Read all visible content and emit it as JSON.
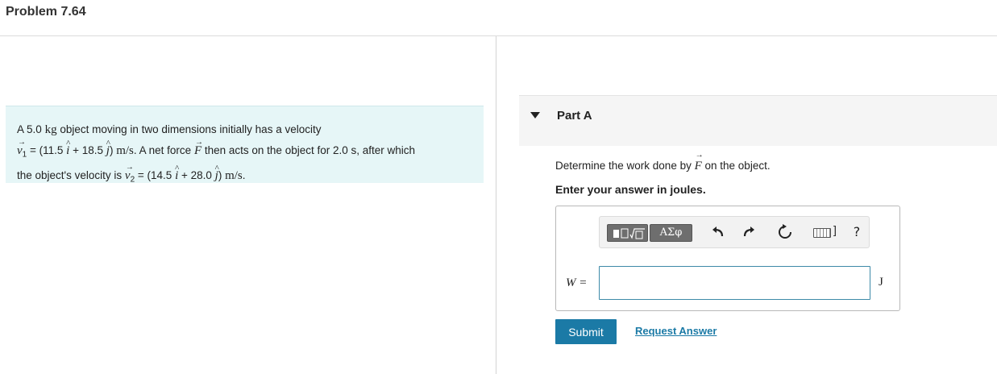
{
  "header": {
    "title": "Problem 7.64"
  },
  "problem": {
    "mass": "5.0",
    "mass_unit": "kg",
    "line1_text": " object moving in two dimensions initially has a velocity",
    "v1_label": "v",
    "v1_sub": "1",
    "v1_x": "11.5",
    "v1_y": "18.5",
    "line2_text": ". A net force ",
    "force_symbol": "F",
    "line2_rest": " then acts on the object for 2.0 s, after which",
    "line3_text": "the object's velocity is ",
    "v2_label": "v",
    "v2_sub": "2",
    "v2_x": "14.5",
    "v2_y": "28.0",
    "velocity_unit": "m/s",
    "i_hat": "i",
    "j_hat": "j",
    "prefix_a": "A "
  },
  "part": {
    "label": "Part A",
    "question_before": "Determine the work done by ",
    "question_symbol": "F",
    "question_after": " on the object.",
    "instruction": "Enter your answer in joules."
  },
  "toolbar": {
    "greek_label": "ΑΣφ",
    "help_label": "?",
    "icons": [
      "templates-icon",
      "greek-icon",
      "undo-icon",
      "redo-icon",
      "reset-icon",
      "keyboard-icon",
      "help-icon"
    ]
  },
  "answer": {
    "variable": "W =",
    "value": "",
    "placeholder": "",
    "unit": "J"
  },
  "actions": {
    "submit_label": "Submit",
    "request_label": "Request Answer"
  },
  "colors": {
    "accent": "#1b7aa6",
    "problem_bg": "#e6f6f7",
    "part_header_bg": "#f5f5f5"
  }
}
